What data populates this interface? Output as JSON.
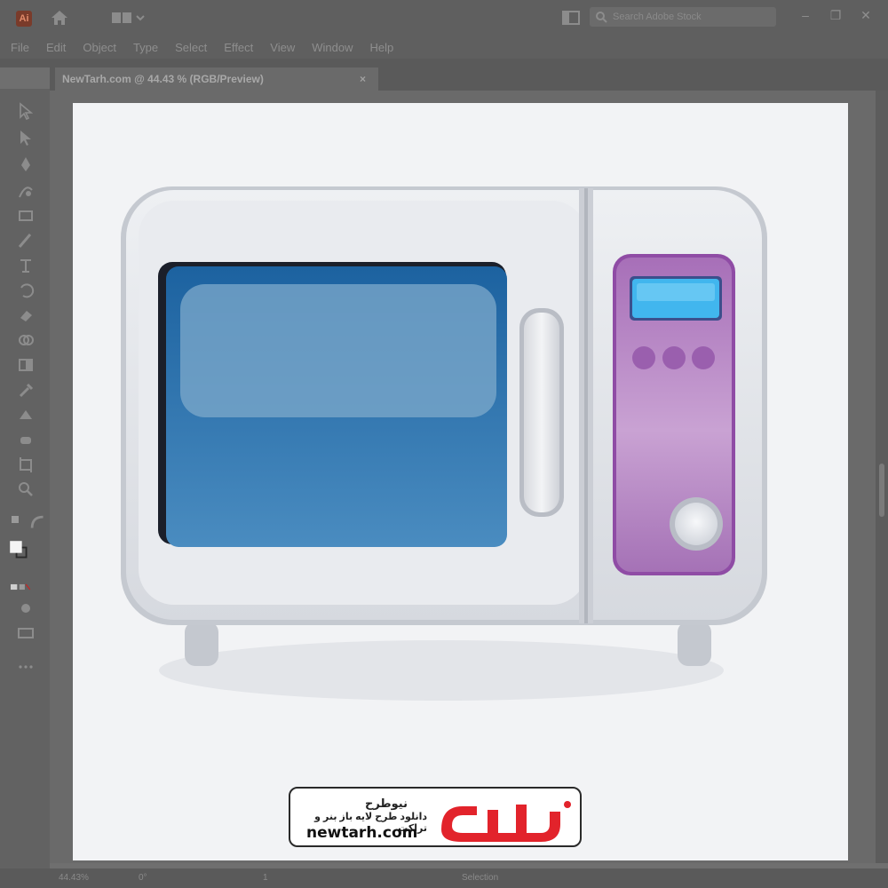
{
  "app": {
    "logo_text": "Ai",
    "search_placeholder": "Search Adobe Stock"
  },
  "menu": [
    "File",
    "Edit",
    "Object",
    "Type",
    "Select",
    "Effect",
    "View",
    "Window",
    "Help"
  ],
  "document_tab": {
    "title": "NewTarh.com @ 44.43 % (RGB/Preview)",
    "close": "×"
  },
  "window_controls": {
    "minimize": "–",
    "restore": "❐",
    "close": "✕"
  },
  "status": {
    "zoom": "44.43%",
    "rotation": "0°",
    "artboard": "1",
    "tool": "Selection"
  },
  "watermark": {
    "name_fa": "نیوطرح",
    "tagline_fa": "دانلود طرح لایه باز بنر و تراکت",
    "url": "newtarh.com",
    "logo_text": "نیوطرح"
  },
  "colors": {
    "ui_dark": "#5f5f5f",
    "artboard": "#f2f3f5",
    "microwave_body": "#e6e8ec",
    "window_blue": "#2c6fa8",
    "control_panel": "#b98ac7",
    "display_cyan": "#41b6ee",
    "brand_red": "#e2232b"
  }
}
